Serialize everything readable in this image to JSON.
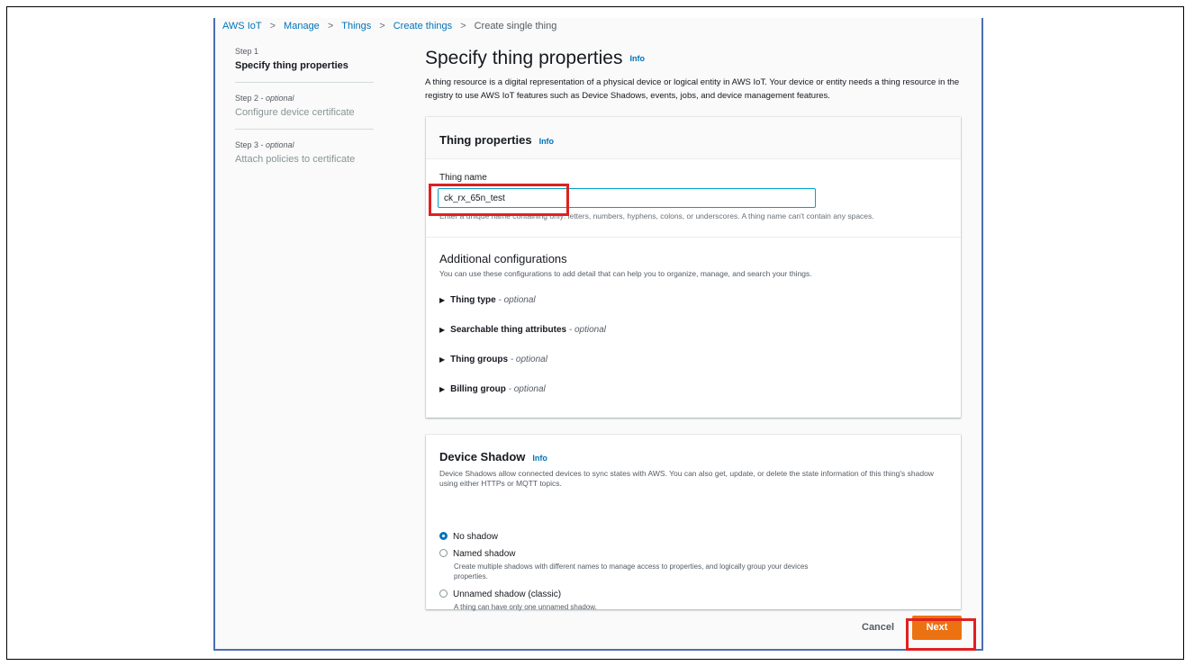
{
  "breadcrumb": {
    "items": [
      "AWS IoT",
      "Manage",
      "Things",
      "Create things"
    ],
    "current": "Create single thing",
    "separator": ">"
  },
  "steps": [
    {
      "step": "Step 1",
      "optional": "",
      "title": "Specify thing properties"
    },
    {
      "step": "Step 2 - ",
      "optional": "optional",
      "title": "Configure device certificate"
    },
    {
      "step": "Step 3 - ",
      "optional": "optional",
      "title": "Attach policies to certificate"
    }
  ],
  "page": {
    "title": "Specify thing properties",
    "info": "Info",
    "description": "A thing resource is a digital representation of a physical device or logical entity in AWS IoT. Your device or entity needs a thing resource in the registry to use AWS IoT features such as Device Shadows, events, jobs, and device management features."
  },
  "thing_properties": {
    "heading": "Thing properties",
    "info": "Info",
    "name_label": "Thing name",
    "name_value": "ck_rx_65n_test",
    "name_hint": "Enter a unique name containing only: letters, numbers, hyphens, colons, or underscores. A thing name can't contain any spaces."
  },
  "additional": {
    "title": "Additional configurations",
    "description": "You can use these configurations to add detail that can help you to organize, manage, and search your things.",
    "expanders": [
      {
        "label": "Thing type",
        "optional": " - optional"
      },
      {
        "label": "Searchable thing attributes",
        "optional": " - optional"
      },
      {
        "label": "Thing groups",
        "optional": " - optional"
      },
      {
        "label": "Billing group",
        "optional": " - optional"
      }
    ]
  },
  "device_shadow": {
    "heading": "Device Shadow",
    "info": "Info",
    "description": "Device Shadows allow connected devices to sync states with AWS. You can also get, update, or delete the state information of this thing's shadow using either HTTPs or MQTT topics.",
    "options": [
      {
        "label": "No shadow",
        "selected": true,
        "desc": ""
      },
      {
        "label": "Named shadow",
        "selected": false,
        "desc": "Create multiple shadows with different names to manage access to properties, and logically group your devices properties."
      },
      {
        "label": "Unnamed shadow (classic)",
        "selected": false,
        "desc": "A thing can have only one unnamed shadow."
      }
    ]
  },
  "footer": {
    "cancel": "Cancel",
    "next": "Next"
  },
  "colors": {
    "link": "#0073bb",
    "primary_button": "#ec7211",
    "annotation_box": "#e02020",
    "frame_border": "#4a6fb3"
  },
  "icons": {
    "breadcrumb_separator": "chevron-right-icon",
    "expander_arrow": "caret-right-icon",
    "radio": "radio-button-icon"
  }
}
